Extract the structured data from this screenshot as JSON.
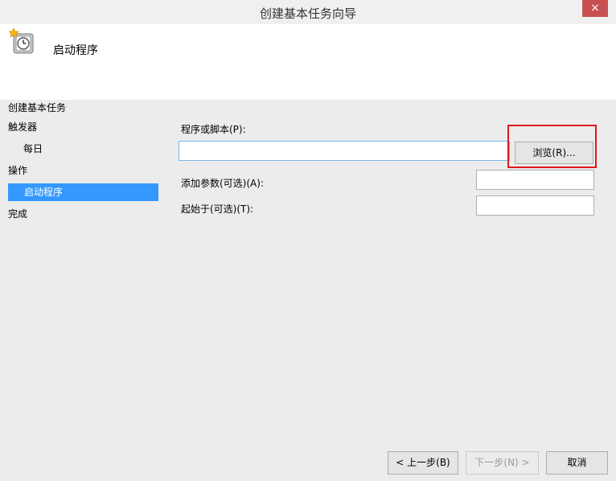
{
  "window": {
    "title": "创建基本任务向导",
    "close": "×"
  },
  "header": {
    "title": "启动程序",
    "icon": "clock-task-icon"
  },
  "sidebar": {
    "items": [
      "创建基本任务",
      "触发器",
      "每日",
      "操作",
      "启动程序",
      "完成"
    ],
    "selected": "启动程序"
  },
  "form": {
    "program_label": "程序或脚本(P):",
    "program_value": "",
    "browse_label": "浏览(R)...",
    "args_label": "添加参数(可选)(A):",
    "args_value": "",
    "start_label": "起始于(可选)(T):",
    "start_value": ""
  },
  "footer": {
    "back_label": "< 上一步(B)",
    "next_label": "下一步(N) >",
    "cancel_label": "取消"
  },
  "colors": {
    "selection": "#3399ff",
    "close": "#c75050",
    "highlight": "#e0161f"
  }
}
